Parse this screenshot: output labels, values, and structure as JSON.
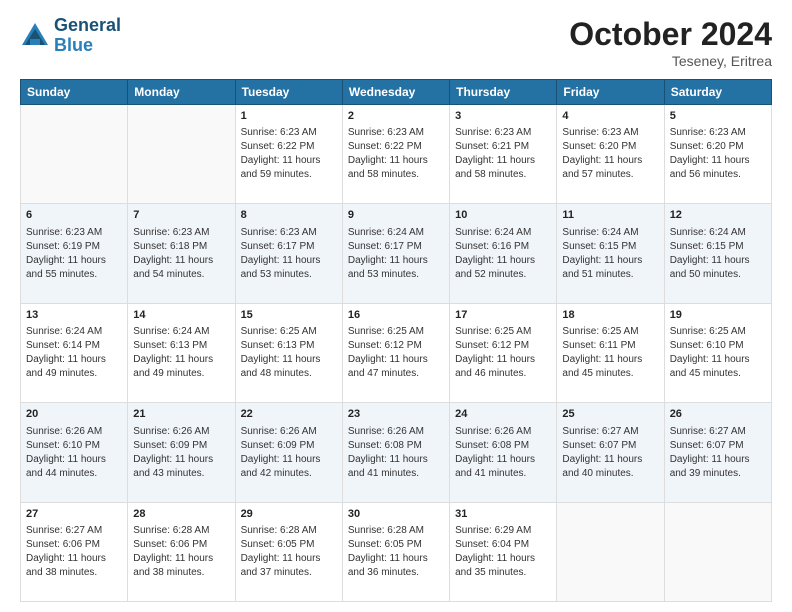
{
  "header": {
    "logo_line1": "General",
    "logo_line2": "Blue",
    "month_year": "October 2024",
    "location": "Teseney, Eritrea"
  },
  "days_of_week": [
    "Sunday",
    "Monday",
    "Tuesday",
    "Wednesday",
    "Thursday",
    "Friday",
    "Saturday"
  ],
  "weeks": [
    [
      {
        "day": "",
        "lines": []
      },
      {
        "day": "",
        "lines": []
      },
      {
        "day": "1",
        "lines": [
          "Sunrise: 6:23 AM",
          "Sunset: 6:22 PM",
          "Daylight: 11 hours",
          "and 59 minutes."
        ]
      },
      {
        "day": "2",
        "lines": [
          "Sunrise: 6:23 AM",
          "Sunset: 6:22 PM",
          "Daylight: 11 hours",
          "and 58 minutes."
        ]
      },
      {
        "day": "3",
        "lines": [
          "Sunrise: 6:23 AM",
          "Sunset: 6:21 PM",
          "Daylight: 11 hours",
          "and 58 minutes."
        ]
      },
      {
        "day": "4",
        "lines": [
          "Sunrise: 6:23 AM",
          "Sunset: 6:20 PM",
          "Daylight: 11 hours",
          "and 57 minutes."
        ]
      },
      {
        "day": "5",
        "lines": [
          "Sunrise: 6:23 AM",
          "Sunset: 6:20 PM",
          "Daylight: 11 hours",
          "and 56 minutes."
        ]
      }
    ],
    [
      {
        "day": "6",
        "lines": [
          "Sunrise: 6:23 AM",
          "Sunset: 6:19 PM",
          "Daylight: 11 hours",
          "and 55 minutes."
        ]
      },
      {
        "day": "7",
        "lines": [
          "Sunrise: 6:23 AM",
          "Sunset: 6:18 PM",
          "Daylight: 11 hours",
          "and 54 minutes."
        ]
      },
      {
        "day": "8",
        "lines": [
          "Sunrise: 6:23 AM",
          "Sunset: 6:17 PM",
          "Daylight: 11 hours",
          "and 53 minutes."
        ]
      },
      {
        "day": "9",
        "lines": [
          "Sunrise: 6:24 AM",
          "Sunset: 6:17 PM",
          "Daylight: 11 hours",
          "and 53 minutes."
        ]
      },
      {
        "day": "10",
        "lines": [
          "Sunrise: 6:24 AM",
          "Sunset: 6:16 PM",
          "Daylight: 11 hours",
          "and 52 minutes."
        ]
      },
      {
        "day": "11",
        "lines": [
          "Sunrise: 6:24 AM",
          "Sunset: 6:15 PM",
          "Daylight: 11 hours",
          "and 51 minutes."
        ]
      },
      {
        "day": "12",
        "lines": [
          "Sunrise: 6:24 AM",
          "Sunset: 6:15 PM",
          "Daylight: 11 hours",
          "and 50 minutes."
        ]
      }
    ],
    [
      {
        "day": "13",
        "lines": [
          "Sunrise: 6:24 AM",
          "Sunset: 6:14 PM",
          "Daylight: 11 hours",
          "and 49 minutes."
        ]
      },
      {
        "day": "14",
        "lines": [
          "Sunrise: 6:24 AM",
          "Sunset: 6:13 PM",
          "Daylight: 11 hours",
          "and 49 minutes."
        ]
      },
      {
        "day": "15",
        "lines": [
          "Sunrise: 6:25 AM",
          "Sunset: 6:13 PM",
          "Daylight: 11 hours",
          "and 48 minutes."
        ]
      },
      {
        "day": "16",
        "lines": [
          "Sunrise: 6:25 AM",
          "Sunset: 6:12 PM",
          "Daylight: 11 hours",
          "and 47 minutes."
        ]
      },
      {
        "day": "17",
        "lines": [
          "Sunrise: 6:25 AM",
          "Sunset: 6:12 PM",
          "Daylight: 11 hours",
          "and 46 minutes."
        ]
      },
      {
        "day": "18",
        "lines": [
          "Sunrise: 6:25 AM",
          "Sunset: 6:11 PM",
          "Daylight: 11 hours",
          "and 45 minutes."
        ]
      },
      {
        "day": "19",
        "lines": [
          "Sunrise: 6:25 AM",
          "Sunset: 6:10 PM",
          "Daylight: 11 hours",
          "and 45 minutes."
        ]
      }
    ],
    [
      {
        "day": "20",
        "lines": [
          "Sunrise: 6:26 AM",
          "Sunset: 6:10 PM",
          "Daylight: 11 hours",
          "and 44 minutes."
        ]
      },
      {
        "day": "21",
        "lines": [
          "Sunrise: 6:26 AM",
          "Sunset: 6:09 PM",
          "Daylight: 11 hours",
          "and 43 minutes."
        ]
      },
      {
        "day": "22",
        "lines": [
          "Sunrise: 6:26 AM",
          "Sunset: 6:09 PM",
          "Daylight: 11 hours",
          "and 42 minutes."
        ]
      },
      {
        "day": "23",
        "lines": [
          "Sunrise: 6:26 AM",
          "Sunset: 6:08 PM",
          "Daylight: 11 hours",
          "and 41 minutes."
        ]
      },
      {
        "day": "24",
        "lines": [
          "Sunrise: 6:26 AM",
          "Sunset: 6:08 PM",
          "Daylight: 11 hours",
          "and 41 minutes."
        ]
      },
      {
        "day": "25",
        "lines": [
          "Sunrise: 6:27 AM",
          "Sunset: 6:07 PM",
          "Daylight: 11 hours",
          "and 40 minutes."
        ]
      },
      {
        "day": "26",
        "lines": [
          "Sunrise: 6:27 AM",
          "Sunset: 6:07 PM",
          "Daylight: 11 hours",
          "and 39 minutes."
        ]
      }
    ],
    [
      {
        "day": "27",
        "lines": [
          "Sunrise: 6:27 AM",
          "Sunset: 6:06 PM",
          "Daylight: 11 hours",
          "and 38 minutes."
        ]
      },
      {
        "day": "28",
        "lines": [
          "Sunrise: 6:28 AM",
          "Sunset: 6:06 PM",
          "Daylight: 11 hours",
          "and 38 minutes."
        ]
      },
      {
        "day": "29",
        "lines": [
          "Sunrise: 6:28 AM",
          "Sunset: 6:05 PM",
          "Daylight: 11 hours",
          "and 37 minutes."
        ]
      },
      {
        "day": "30",
        "lines": [
          "Sunrise: 6:28 AM",
          "Sunset: 6:05 PM",
          "Daylight: 11 hours",
          "and 36 minutes."
        ]
      },
      {
        "day": "31",
        "lines": [
          "Sunrise: 6:29 AM",
          "Sunset: 6:04 PM",
          "Daylight: 11 hours",
          "and 35 minutes."
        ]
      },
      {
        "day": "",
        "lines": []
      },
      {
        "day": "",
        "lines": []
      }
    ]
  ]
}
